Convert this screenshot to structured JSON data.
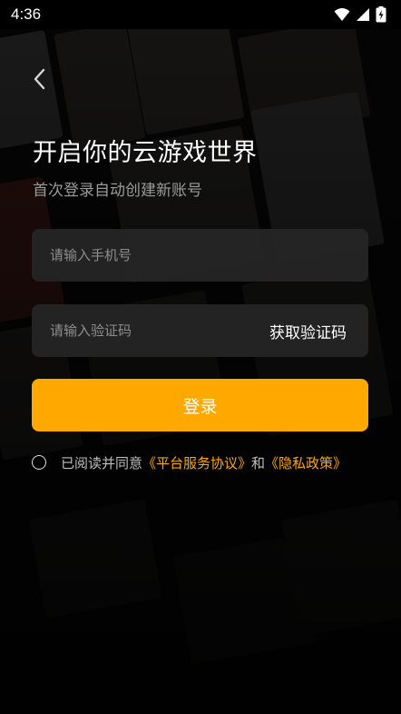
{
  "status_bar": {
    "time": "4:36"
  },
  "icons": {
    "back": "chevron-left-icon",
    "wifi": "wifi-icon",
    "signal": "signal-icon",
    "battery": "battery-charging-icon"
  },
  "heading": {
    "title": "开启你的云游戏世界",
    "subtitle": "首次登录自动创建新账号"
  },
  "form": {
    "phone_placeholder": "请输入手机号",
    "phone_value": "",
    "code_placeholder": "请输入验证码",
    "code_value": "",
    "get_code_label": "获取验证码",
    "login_label": "登录"
  },
  "agreement": {
    "prefix": "已阅读并同意",
    "terms_link": "《平台服务协议》",
    "and": "和",
    "privacy_link": "《隐私政策》",
    "checked": false
  },
  "colors": {
    "accent": "#ffa800",
    "background": "#0a0a0a",
    "field": "#262626"
  }
}
